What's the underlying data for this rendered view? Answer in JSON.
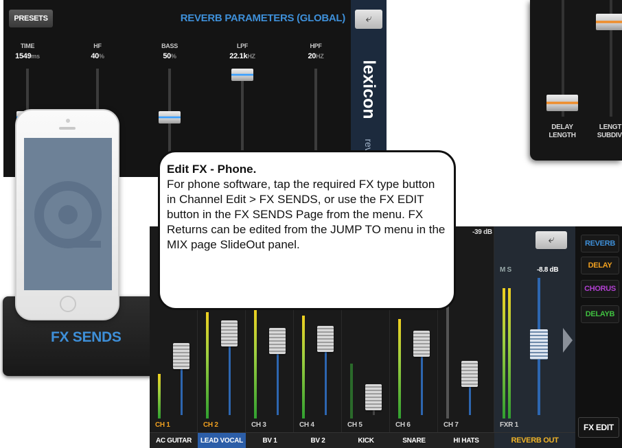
{
  "reverb_panel": {
    "presets_label": "PRESETS",
    "title": "REVERB PARAMETERS (GLOBAL)",
    "back_icon": "back-arrow-icon",
    "logo_text": "lexicon",
    "logo_sub": "reve",
    "params": [
      {
        "label": "TIME",
        "value": "1549",
        "unit": "ms"
      },
      {
        "label": "HF",
        "value": "40",
        "unit": "%"
      },
      {
        "label": "BASS",
        "value": "50",
        "unit": "%"
      },
      {
        "label": "LPF",
        "value": "22.1k",
        "unit": "HZ"
      },
      {
        "label": "HPF",
        "value": "20",
        "unit": "HZ"
      }
    ]
  },
  "delay_panel": {
    "labels": [
      "DELAY LENGTH",
      "LENGT SUBDIVI"
    ]
  },
  "fx_sends_panel": {
    "label": "FX SENDS"
  },
  "callout": {
    "title": "Edit FX - Phone",
    "body": "For phone software, tap the required FX type button in Channel Edit > FX SENDS, or use the FX EDIT button in the FX SENDS Page from the menu. FX Returns can be edited from the JUMP TO menu in the MIX page SlideOut panel."
  },
  "mixer": {
    "top_db": "-39 dB",
    "channels": [
      {
        "num": "CH 1",
        "name": "AC GUITAR",
        "num_color": "#f0a020",
        "selected": false
      },
      {
        "num": "CH 2",
        "name": "LEAD VOCAL",
        "num_color": "#f0a020",
        "selected": true
      },
      {
        "num": "CH 3",
        "name": "BV 1",
        "num_color": "#cfcfcf",
        "selected": false
      },
      {
        "num": "CH 4",
        "name": "BV 2",
        "num_color": "#cfcfcf",
        "selected": false
      },
      {
        "num": "CH 5",
        "name": "KICK",
        "num_color": "#cfcfcf",
        "selected": false
      },
      {
        "num": "CH 6",
        "name": "SNARE",
        "num_color": "#cfcfcf",
        "selected": false
      },
      {
        "num": "CH 7",
        "name": "HI HATS",
        "num_color": "#cfcfcf",
        "selected": false
      }
    ],
    "fx_return": {
      "num": "FXR 1",
      "ms": "M S",
      "db": "-8.8 dB",
      "name": "REVERB OUT"
    },
    "fx_types": [
      {
        "label": "REVERB",
        "color": "#3e8fd8"
      },
      {
        "label": "DELAY",
        "color": "#f0a020"
      },
      {
        "label": "CHORUS",
        "color": "#b040d0"
      },
      {
        "label": "DELAYB",
        "color": "#40c040"
      }
    ],
    "fx_edit_label": "FX EDIT"
  }
}
